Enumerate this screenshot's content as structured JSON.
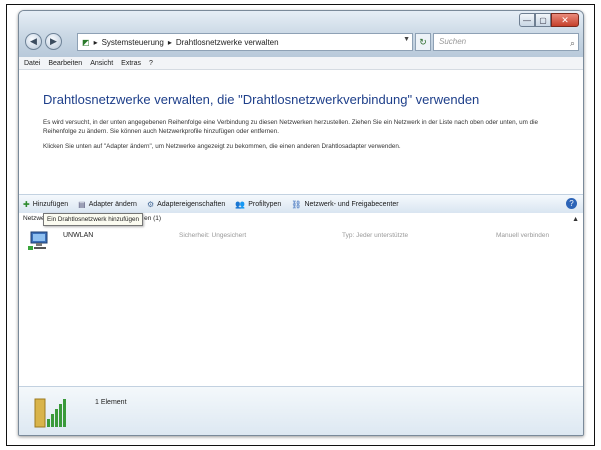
{
  "address": {
    "crumbs": [
      "Systemsteuerung",
      "Drahtlosnetzwerke verwalten"
    ],
    "search_placeholder": "Suchen"
  },
  "menu": [
    "Datei",
    "Bearbeiten",
    "Ansicht",
    "Extras",
    "?"
  ],
  "content": {
    "heading": "Drahtlosnetzwerke verwalten, die \"Drahtlosnetzwerkverbindung\" verwenden",
    "para1": "Es wird versucht, in der unten angegebenen Reihenfolge eine Verbindung zu diesen Netzwerken herzustellen. Ziehen Sie ein Netzwerk in der Liste nach oben oder unten, um die Reihenfolge zu ändern. Sie können auch Netzwerkprofile hinzufügen oder entfernen.",
    "para2": "Klicken Sie unten auf \"Adapter ändern\", um Netzwerke angezeigt zu bekommen, die einen anderen Drahtlosadapter verwenden."
  },
  "toolbar": {
    "add": "Hinzufügen",
    "change_adapter": "Adapter ändern",
    "adapter_props": "Adaptereigenschaften",
    "profile_types": "Profiltypen",
    "network_center": "Netzwerk- und Freigabecenter"
  },
  "list": {
    "header_left": "Netzwerk",
    "header_right": "en (1)",
    "tooltip": "Ein Drahtlosnetzwerk hinzufügen",
    "networks": [
      {
        "name": "UNWLAN",
        "security": "Sicherheit: Ungesichert",
        "type": "Typ: Jeder unterstützte",
        "connect": "Manuell verbinden"
      }
    ]
  },
  "details": {
    "count": "1 Element"
  },
  "colors": {
    "heading": "#1e3f8a",
    "toolbar_bg": "#d9e5f1",
    "close_button": "#c6402b"
  }
}
